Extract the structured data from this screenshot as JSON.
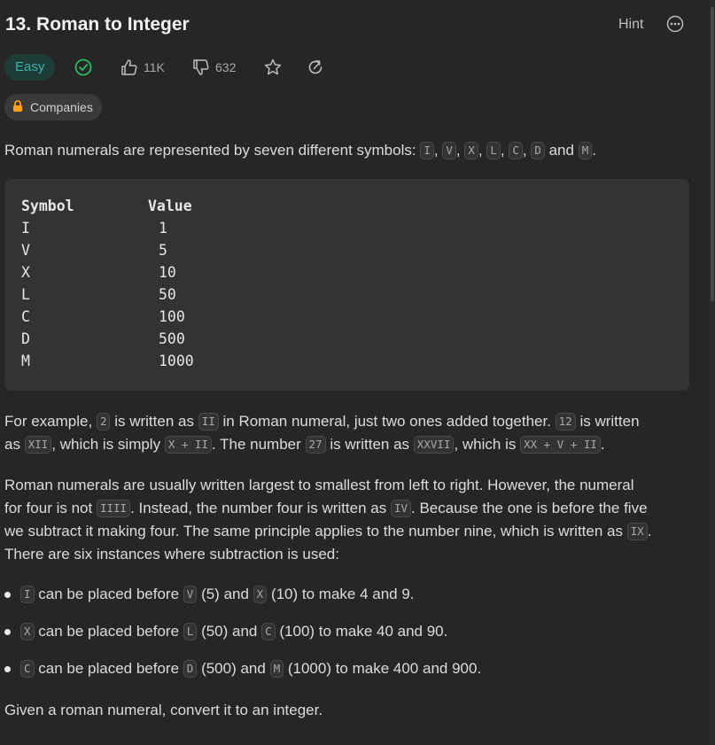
{
  "problem": {
    "title": "13. Roman to Integer",
    "hint_label": "Hint",
    "difficulty": "Easy",
    "likes": "11K",
    "dislikes": "632",
    "companies_label": "Companies"
  },
  "colors": {
    "accent_easy": "#3cb3a7",
    "solved_check": "#2cbb5d",
    "background": "#262626"
  },
  "icons": {
    "more": "more-horizontal-icon",
    "solved": "check-circle-icon",
    "like": "thumbs-up-icon",
    "dislike": "thumbs-down-icon",
    "favorite": "star-icon",
    "share": "refresh-share-icon",
    "lock": "lock-icon"
  },
  "intro": {
    "text": "Roman numerals are represented by seven different symbols:",
    "symbols": [
      "I",
      "V",
      "X",
      "L",
      "C",
      "D",
      "M"
    ],
    "sep1": ",",
    "and": "and",
    "end": "."
  },
  "table": {
    "header": [
      "Symbol",
      "Value"
    ],
    "rows": [
      [
        "I",
        "1"
      ],
      [
        "V",
        "5"
      ],
      [
        "X",
        "10"
      ],
      [
        "L",
        "50"
      ],
      [
        "C",
        "100"
      ],
      [
        "D",
        "500"
      ],
      [
        "M",
        "1000"
      ]
    ]
  },
  "example": {
    "t1": "For example,",
    "c1": "2",
    "t2": "is written as",
    "c2": "II",
    "t3": "in Roman numeral, just two ones added together.",
    "c3": "12",
    "t4": "is written",
    "t5": "as",
    "c4": "XII",
    "t6": ", which is simply",
    "c5": "X + II",
    "t7": ". The number",
    "c6": "27",
    "t8": "is written as",
    "c7": "XXVII",
    "t9": ", which is",
    "c8": "XX + V + II",
    "t10": "."
  },
  "order": {
    "t1": "Roman numerals are usually written largest to smallest from left to right. However, the numeral",
    "t2": "for four is not",
    "c1": "IIII",
    "t3": ". Instead, the number four is written as",
    "c2": "IV",
    "t4": ". Because the one is before the five",
    "t5": "we subtract it making four. The same principle applies to the number nine, which is written as",
    "c3": "IX",
    "t6": ".",
    "t7": "There are six instances where subtraction is used:"
  },
  "rules": [
    {
      "a": "I",
      "t1": "can be placed before",
      "b": "V",
      "t2": "(5) and",
      "c": "X",
      "t3": "(10) to make 4 and 9."
    },
    {
      "a": "X",
      "t1": "can be placed before",
      "b": "L",
      "t2": "(50) and",
      "c": "C",
      "t3": "(100) to make 40 and 90."
    },
    {
      "a": "C",
      "t1": "can be placed before",
      "b": "D",
      "t2": "(500) and",
      "c": "M",
      "t3": "(1000) to make 400 and 900."
    }
  ],
  "closing": "Given a roman numeral, convert it to an integer."
}
